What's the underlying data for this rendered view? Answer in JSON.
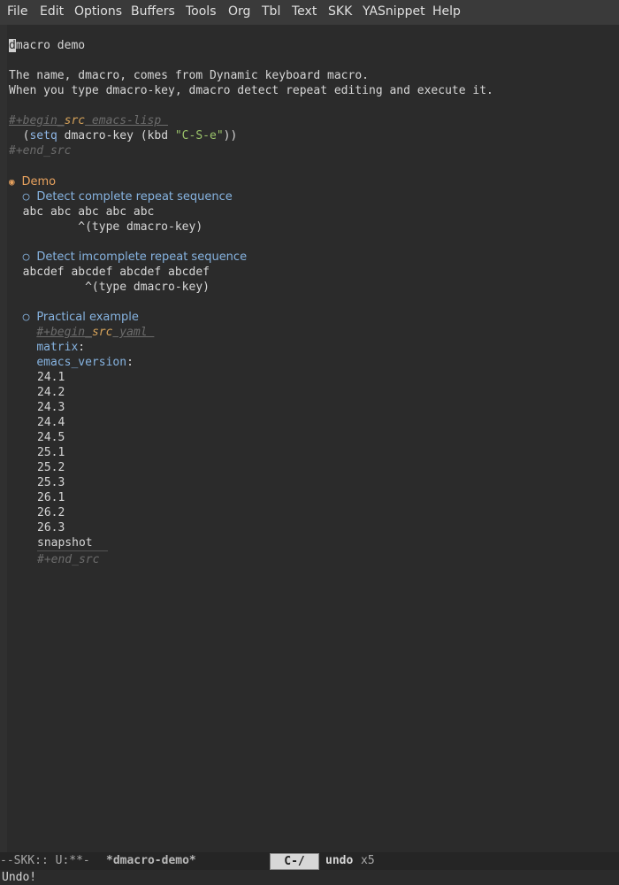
{
  "menubar": [
    "File",
    "Edit",
    "Options",
    "Buffers",
    "Tools",
    "Org",
    "Tbl",
    "Text",
    "SKK",
    "YASnippet",
    "Help"
  ],
  "buffer": {
    "title_first_char": "d",
    "title_rest": "macro demo",
    "intro_line1": "The name, dmacro, comes from Dynamic keyboard macro.",
    "intro_line2": "When you type dmacro-key, dmacro detect repeat editing and execute it.",
    "src1_begin_a": "#+begin_",
    "src1_begin_b": "src",
    "src1_begin_c": " emacs-lisp ",
    "src1_code_a": "  (",
    "src1_code_b": "setq",
    "src1_code_c": " dmacro-key (kbd ",
    "src1_code_d": "\"C-S-e\"",
    "src1_code_e": "))",
    "src1_end": "#+end_src",
    "heading1_bullet": "◉",
    "heading1": "Demo",
    "sub_bullet": "○",
    "sub1": "Detect complete repeat sequence",
    "sub1_line1": "  abc abc abc abc abc",
    "sub1_line2": "          ^(type dmacro-key)",
    "sub2": "Detect imcomplete repeat sequence",
    "sub2_line1": "  abcdef abcdef abcdef abcdef",
    "sub2_line2": "           ^(type dmacro-key)",
    "sub3": "Practical example",
    "src2_begin_a": "#+begin_",
    "src2_begin_b": "src",
    "src2_begin_c": " yaml ",
    "yaml_key1": "matrix",
    "yaml_key2": "emacs_version",
    "yaml_colon": ":",
    "versions": [
      "24.1",
      "24.2",
      "24.3",
      "24.4",
      "24.5",
      "25.1",
      "25.2",
      "25.3",
      "26.1",
      "26.2",
      "26.3"
    ],
    "snapshot": "snapshot",
    "src2_end": "#+end_src"
  },
  "modeline": {
    "status": "--SKK:: U:**-  ",
    "buffer_name": "*dmacro-demo*",
    "key": "C-/",
    "command": "undo",
    "count": "x5"
  },
  "echo": "Undo!"
}
